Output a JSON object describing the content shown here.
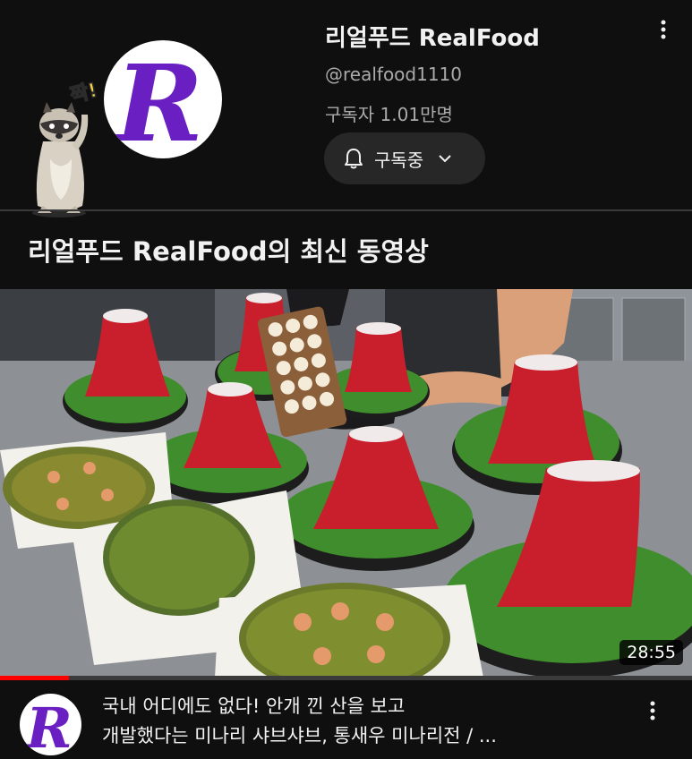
{
  "channel": {
    "name": "리얼푸드 RealFood",
    "handle": "@realfood1110",
    "subscribers": "구독자 1.01만명",
    "logo_letter": "R",
    "sticker_text": "짝!",
    "subscribe_label": "구독중",
    "subscribe_icon": "bell-icon",
    "dropdown_icon": "chevron-down-icon",
    "more_icon": "more-vert-icon"
  },
  "section": {
    "title": "리얼푸드 RealFood의 최신 동영상"
  },
  "video": {
    "duration": "28:55",
    "watch_progress": 0.1,
    "title_line1": "국내 어디에도 없다! 안개 낀 산을 보고",
    "title_line2": "개발했다는 미나리 샤브샤브, 통새우 미나리전 / ...",
    "more_icon": "more-vert-icon"
  },
  "colors": {
    "background": "#0f0f0f",
    "logo_purple": "#6a1fc2",
    "progress_red": "#ff0000",
    "button_bg": "#272727",
    "secondary_text": "#aaaaaa"
  }
}
